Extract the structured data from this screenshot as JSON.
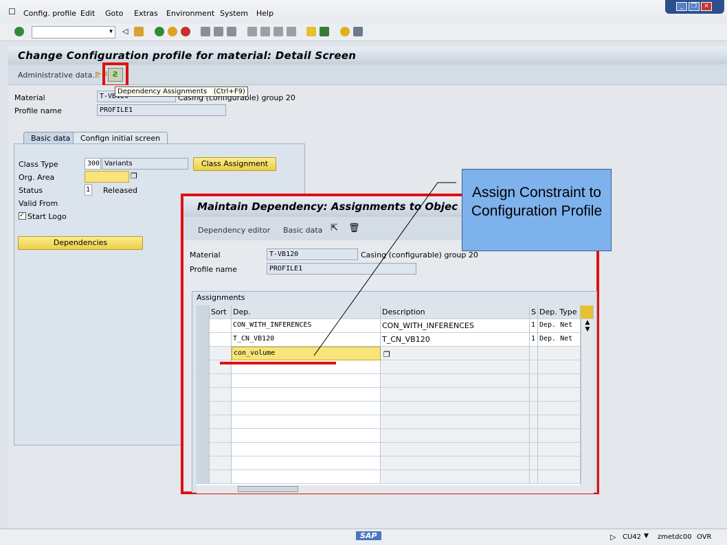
{
  "menu": [
    "Config. profile",
    "Edit",
    "Goto",
    "Extras",
    "Environment",
    "System",
    "Help"
  ],
  "title": "Change Configuration profile for material: Detail Screen",
  "app_toolbar": {
    "admin_label": "Administrative data...",
    "tooltip": "Dependency Assignments   (Ctrl+F9)"
  },
  "header": {
    "material_label": "Material",
    "material_value": "T-VB120",
    "material_desc": "Casing (configurable) group 20",
    "profile_label": "Profile name",
    "profile_value": "PROFILE1"
  },
  "tabs": [
    "Basic data",
    "Confign initial screen"
  ],
  "basic": {
    "class_type_label": "Class Type",
    "class_type_value": "300",
    "class_type_desc": "Variants",
    "class_assignment": "Class Assignment",
    "org_area_label": "Org. Area",
    "org_area_value": "",
    "status_label": "Status",
    "status_value": "1",
    "status_desc": "Released",
    "valid_from_label": "Valid From",
    "start_logo_label": "Start Logo",
    "start_logo_checked": true,
    "dependencies": "Dependencies"
  },
  "popup": {
    "title": "Maintain Dependency: Assignments to Objec",
    "dep_editor": "Dependency editor",
    "basic_data": "Basic data",
    "material_label": "Material",
    "material_value": "T-VB120",
    "material_desc": "Casing (configurable) group 20",
    "profile_label": "Profile name",
    "profile_value": "PROFILE1",
    "group_label": "Assignments",
    "columns": [
      "Sort",
      "Dep.",
      "Description",
      "S",
      "Dep. Type"
    ],
    "rows": [
      {
        "sort": "",
        "dep": "CON_WITH_INFERENCES",
        "desc": "CON_WITH_INFERENCES",
        "s": "1",
        "type": "Dep. Net"
      },
      {
        "sort": "",
        "dep": "T_CN_VB120",
        "desc": "T_CN_VB120",
        "s": "1",
        "type": "Dep. Net"
      },
      {
        "sort": "",
        "dep": "con_volume",
        "desc": "",
        "s": "",
        "type": ""
      }
    ],
    "empty_rows": 9
  },
  "callout": "Assign Constraint to Configuration Profile",
  "status": {
    "logo": "SAP",
    "tcode": "CU42",
    "server": "zmetdc00",
    "mode": "OVR"
  },
  "colors": {
    "highlight": "#e01010",
    "callout": "#7eb2ec",
    "required": "#f7e47a"
  }
}
